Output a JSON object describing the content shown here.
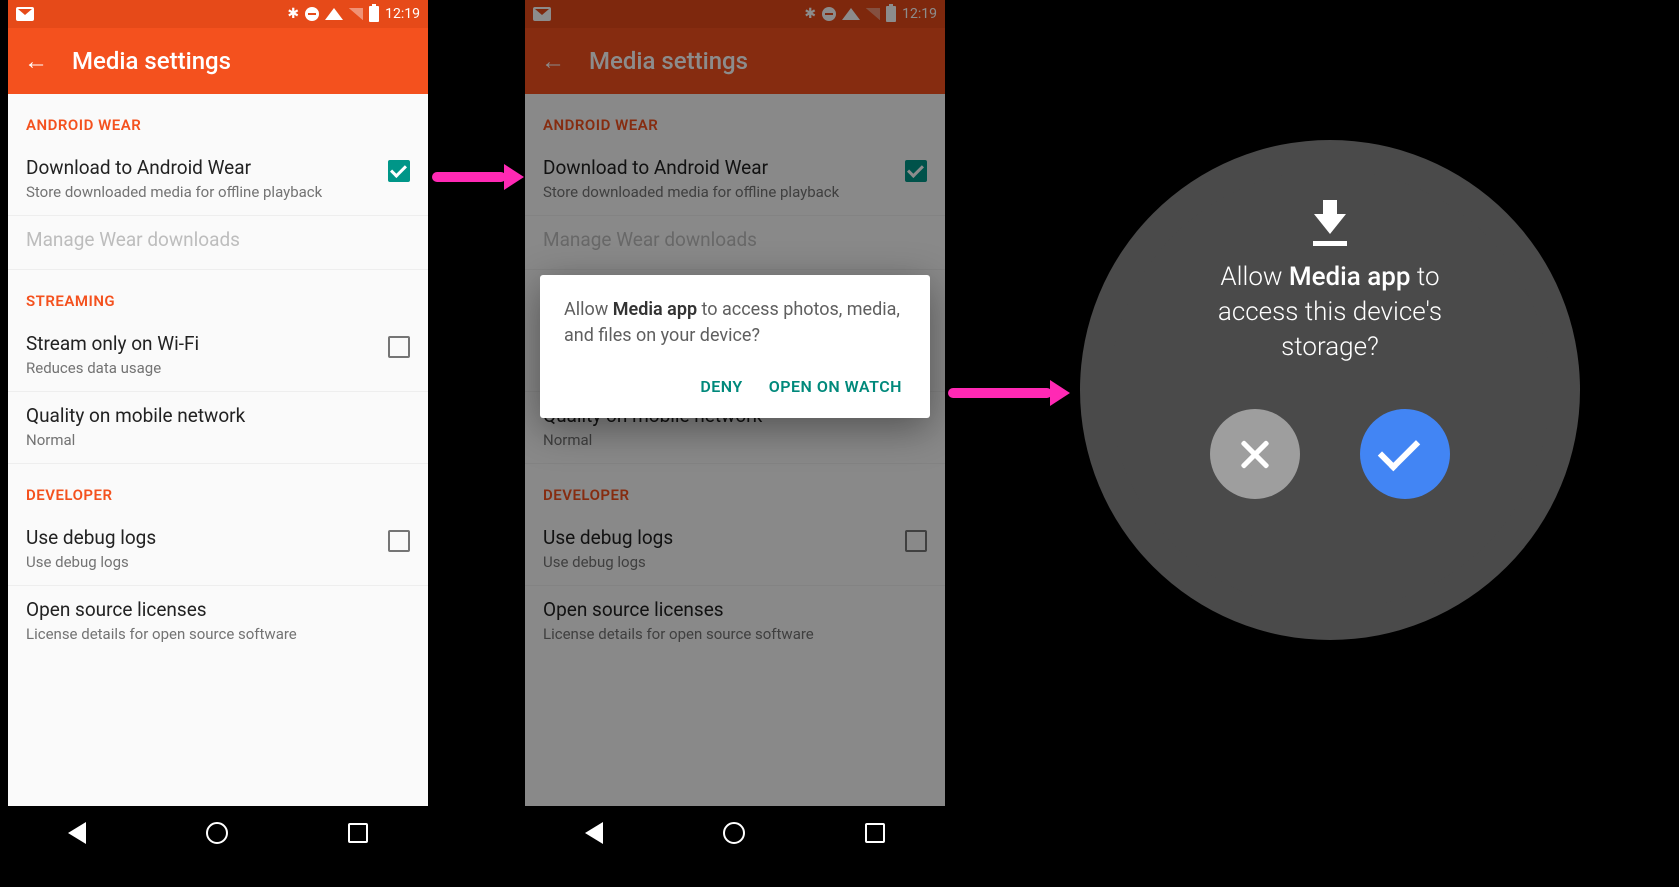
{
  "status": {
    "time": "12:19"
  },
  "appbar": {
    "title": "Media settings"
  },
  "sections": {
    "wear_header": "ANDROID WEAR",
    "download": {
      "title": "Download to Android Wear",
      "sub": "Store downloaded media for offline playback"
    },
    "manage": {
      "title": "Manage Wear downloads"
    },
    "streaming_header": "STREAMING",
    "wifi": {
      "title": "Stream only on Wi-Fi",
      "sub": "Reduces data usage"
    },
    "quality": {
      "title": "Quality on mobile network",
      "sub": "Normal"
    },
    "dev_header": "DEVELOPER",
    "debug": {
      "title": "Use debug logs",
      "sub": "Use debug logs"
    },
    "oss": {
      "title": "Open source licenses",
      "sub": "License details for open source software"
    }
  },
  "dialog": {
    "pre": "Allow ",
    "app": "Media app",
    "post": " to access photos, media, and files on your device?",
    "deny": "DENY",
    "open": "OPEN ON WATCH"
  },
  "watch": {
    "pre": "Allow ",
    "app": "Media app",
    "post1": "  to",
    "post2": "access this device's",
    "post3": "storage?"
  }
}
